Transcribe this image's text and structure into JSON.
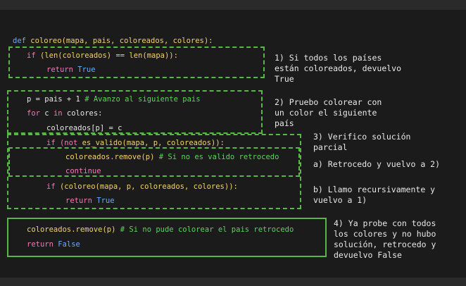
{
  "code": {
    "def_kw": "def",
    "func_name": "coloreo",
    "def_params": "(mapa, pais, coloreados, colores):",
    "l1_kw": "if",
    "l1_rest": "(len(coloreados) == len(mapa)):",
    "l2_kw": "return",
    "l2_val": "True",
    "l3_code": "p = pais + 1",
    "l3_comment": "# Avanzo al siguiente pais",
    "l4_for": "for",
    "l4_mid": " c ",
    "l4_in": "in",
    "l4_rest": " colores:",
    "l5_code": "coloreados[p] = c",
    "l6_kw": "if",
    "l6_not": "(not",
    "l6_rest": " es_valido(mapa, p, coloreados)):",
    "l7_code": "coloreados.remove(p)",
    "l7_comment": "# Si no es valido retrocedo",
    "l8_kw": "continue",
    "l9_kw": "if",
    "l9_rest": "(coloreo(mapa, p, coloreados, colores)):",
    "l10_kw": "return",
    "l10_val": "True",
    "l11_code": "coloreados.remove(p)",
    "l11_comment": "# Si no pude colorear el pais retrocedo",
    "l12_kw": "return",
    "l12_val": "False"
  },
  "notes": {
    "n1": "1) Si todos los países\nestán coloreados, devuelvo\nTrue",
    "n2": "2) Pruebo colorear con\nun color el siguiente\npaís",
    "n3": "3) Verifico solución\nparcial",
    "n3a": "a) Retrocedo y vuelvo a 2)",
    "n3b": "b) Llamo recursivamente y\nvuelvo a 1)",
    "n4": "4) Ya probe con todos\nlos colores y no hubo\nsolución, retrocedo y\ndevuelvo False"
  },
  "colors": {
    "background": "#1b1b1b",
    "box_green": "#57b846",
    "keyword": "#f07ab8",
    "function": "#f3d36b",
    "constant": "#6fa8ff",
    "comment": "#5fd25f"
  }
}
